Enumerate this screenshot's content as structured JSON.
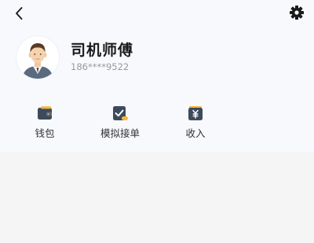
{
  "profile": {
    "name": "司机师傅",
    "phone": "186****9522"
  },
  "icons": {
    "back": "chevron-left-icon",
    "settings": "gear-icon",
    "avatar": "driver-avatar"
  },
  "menu": [
    {
      "label": "钱包",
      "icon": "wallet-icon"
    },
    {
      "label": "模拟接单",
      "icon": "order-check-icon"
    },
    {
      "label": "收入",
      "icon": "yuan-income-icon"
    }
  ],
  "colors": {
    "header_bg": "#f7f9fd",
    "page_bg": "#f5f5f5",
    "icon_dark": "#3d4a5c",
    "icon_accent": "#f5b73b"
  }
}
